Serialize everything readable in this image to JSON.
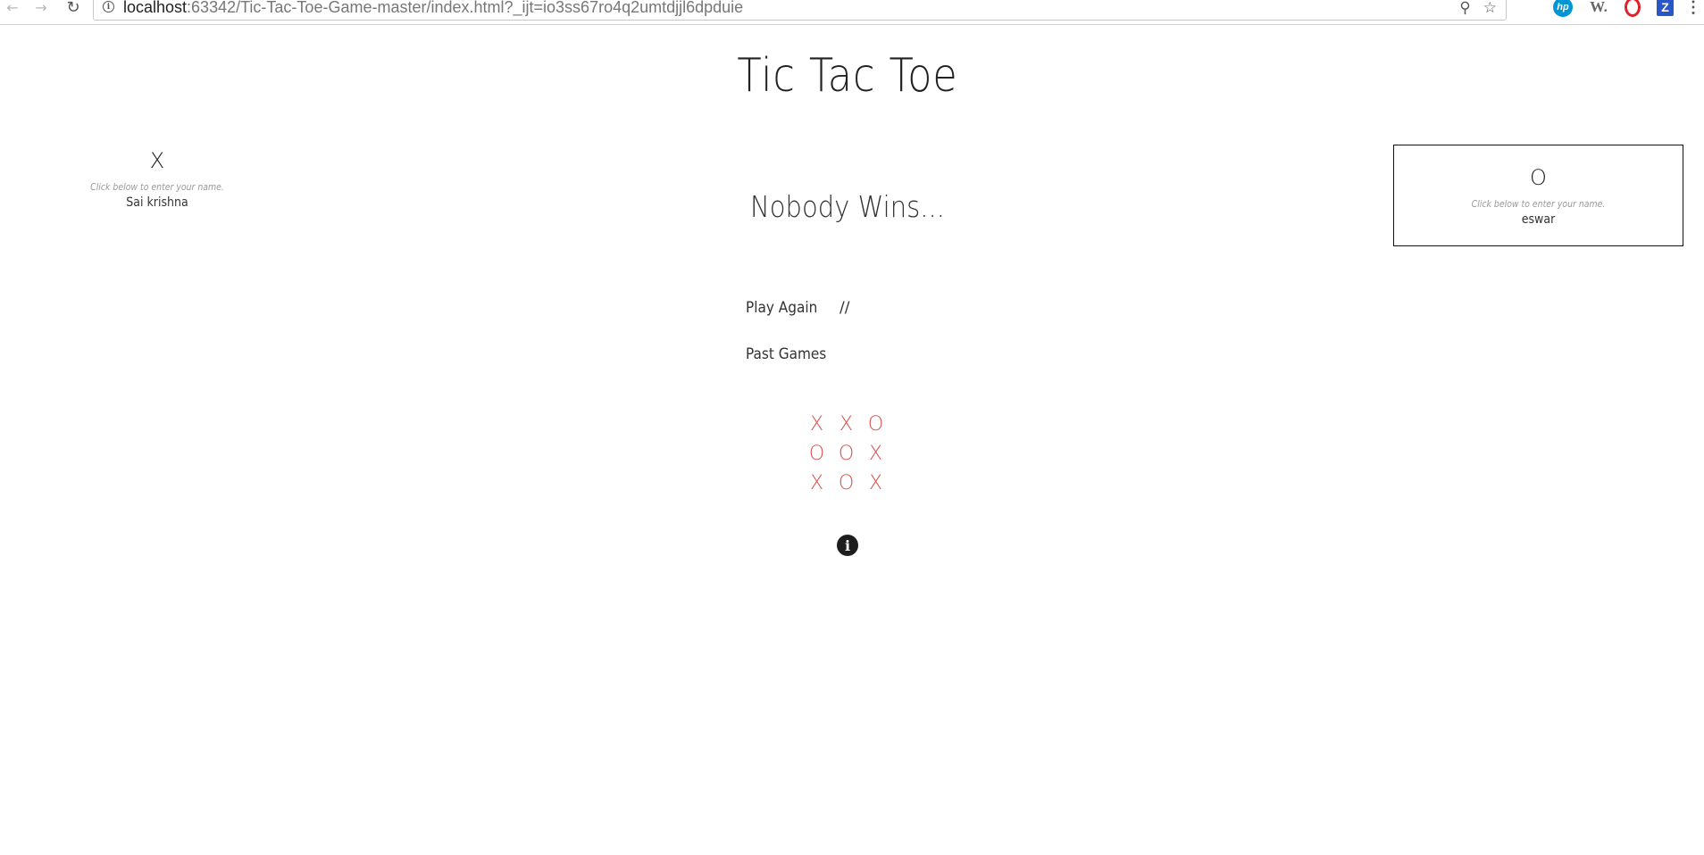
{
  "browser": {
    "url_host": "localhost",
    "url_path": ":63342/Tic-Tac-Toe-Game-master/index.html?_ijt=io3ss67ro4q2umtdjjl6dpduie",
    "back_glyph": "←",
    "forward_glyph": "→",
    "reload_glyph": "↻",
    "info_glyph": "i",
    "zoom_glyph": "⚲",
    "star_glyph": "☆",
    "extensions": {
      "hp": "hp",
      "w": "W.",
      "z": "Z",
      "menu": "⋮"
    }
  },
  "page": {
    "title": "Tic Tac Toe",
    "status": "Nobody Wins...",
    "play_again": "Play Again",
    "separator": "//",
    "past_games": "Past Games",
    "info_glyph": "i"
  },
  "players": {
    "left": {
      "symbol": "X",
      "hint": "Click below to enter your name.",
      "name": "Sai krishna"
    },
    "right": {
      "symbol": "O",
      "hint": "Click below to enter your name.",
      "name": "eswar"
    }
  },
  "board": {
    "cells": [
      "X",
      "X",
      "O",
      "O",
      "O",
      "X",
      "X",
      "O",
      "X"
    ]
  },
  "colors": {
    "mark_color": "#d9534f",
    "active_border": "#111111"
  }
}
